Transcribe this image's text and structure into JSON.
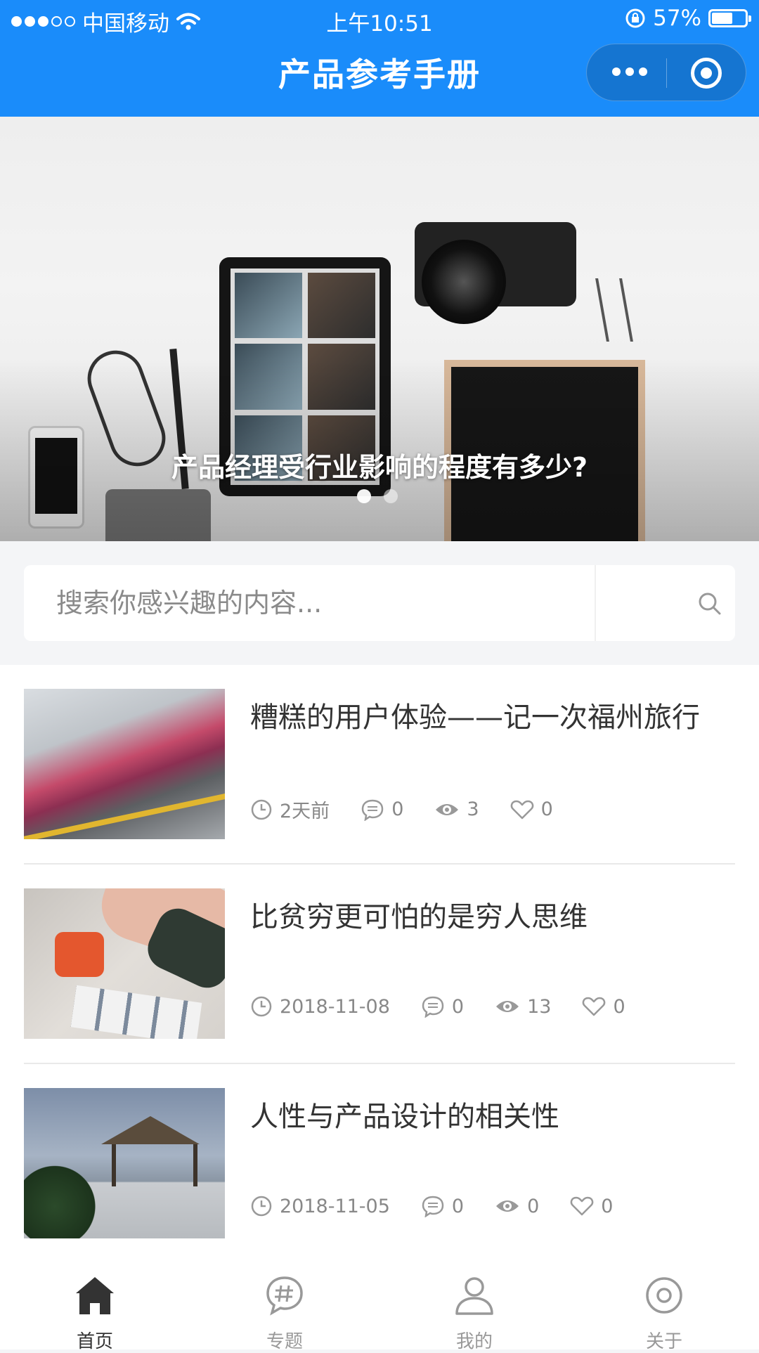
{
  "status_bar": {
    "carrier": "中国移动",
    "time": "上午10:51",
    "battery": "57%"
  },
  "nav": {
    "title": "产品参考手册"
  },
  "banner": {
    "caption": "产品经理受行业影响的程度有多少?",
    "active_slide": 1,
    "slide_count": 2
  },
  "search": {
    "placeholder": "搜索你感兴趣的内容..."
  },
  "articles": [
    {
      "title": "糟糕的用户体验——记一次福州旅行",
      "date": "2天前",
      "comments": "0",
      "views": "3",
      "likes": "0"
    },
    {
      "title": "比贫穷更可怕的是穷人思维",
      "date": "2018-11-08",
      "comments": "0",
      "views": "13",
      "likes": "0"
    },
    {
      "title": "人性与产品设计的相关性",
      "date": "2018-11-05",
      "comments": "0",
      "views": "0",
      "likes": "0"
    }
  ],
  "tabbar": {
    "items": [
      {
        "label": "首页",
        "icon": "home-icon",
        "active": true
      },
      {
        "label": "专题",
        "icon": "topic-icon",
        "active": false
      },
      {
        "label": "我的",
        "icon": "user-icon",
        "active": false
      },
      {
        "label": "关于",
        "icon": "about-icon",
        "active": false
      }
    ]
  },
  "colors": {
    "primary": "#1a8cfa",
    "tab_active": "#333333",
    "tab_inactive": "#999999"
  }
}
